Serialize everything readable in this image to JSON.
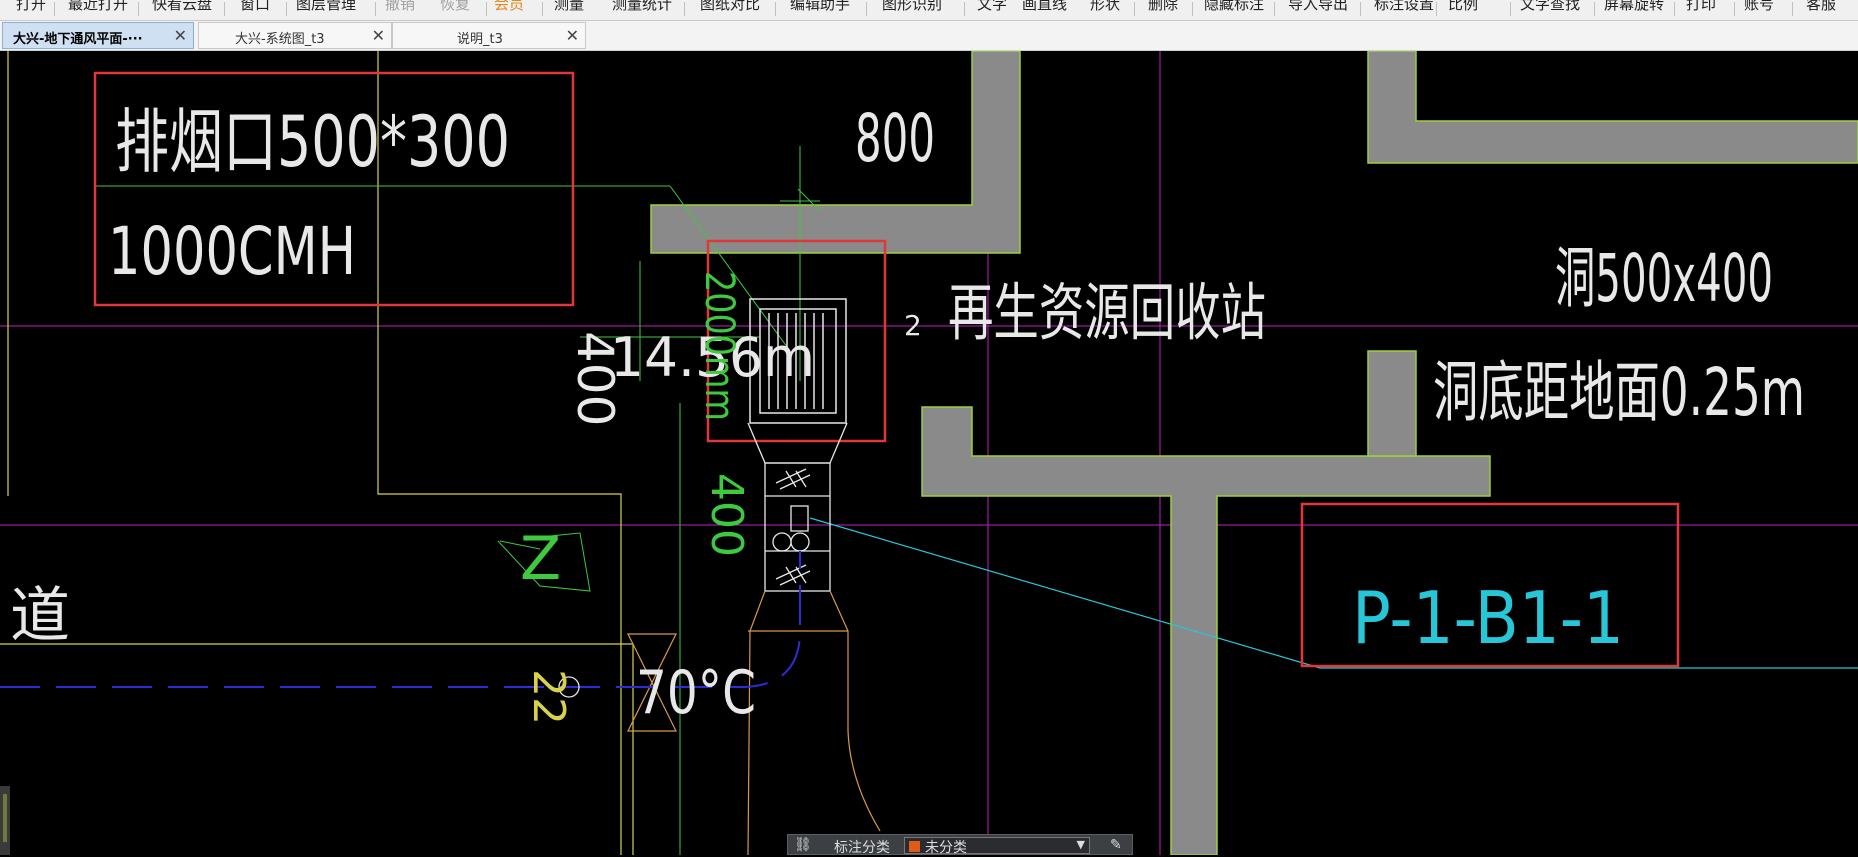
{
  "menu": {
    "items": [
      {
        "label": "打开",
        "state": "normal"
      },
      {
        "label": "最近打开",
        "state": "normal"
      },
      {
        "label": "快看云盘",
        "state": "normal"
      },
      {
        "label": "窗口",
        "state": "normal"
      },
      {
        "label": "图层管理",
        "state": "normal"
      },
      {
        "label": "撤销",
        "state": "disabled"
      },
      {
        "label": "恢复",
        "state": "disabled"
      },
      {
        "label": "会员",
        "state": "highlight"
      },
      {
        "label": "测量",
        "state": "normal"
      },
      {
        "label": "测量统计",
        "state": "normal"
      },
      {
        "label": "图纸对比",
        "state": "normal"
      },
      {
        "label": "编辑助手",
        "state": "normal"
      },
      {
        "label": "图形识别",
        "state": "normal"
      },
      {
        "label": "文字",
        "state": "normal"
      },
      {
        "label": "画直线",
        "state": "normal"
      },
      {
        "label": "形状",
        "state": "normal"
      },
      {
        "label": "删除",
        "state": "normal"
      },
      {
        "label": "隐藏标注",
        "state": "normal"
      },
      {
        "label": "导入导出",
        "state": "normal"
      },
      {
        "label": "标注设置",
        "state": "normal"
      },
      {
        "label": "比例",
        "state": "normal"
      },
      {
        "label": "文字查找",
        "state": "normal"
      },
      {
        "label": "屏幕旋转",
        "state": "normal"
      },
      {
        "label": "打印",
        "state": "normal"
      },
      {
        "label": "账号",
        "state": "normal"
      },
      {
        "label": "客服",
        "state": "normal"
      }
    ]
  },
  "tabs": [
    {
      "label": "大兴-地下通风平面-···",
      "active": true,
      "close": "✕"
    },
    {
      "label": "大兴-系统图_t3",
      "active": false,
      "close": "✕"
    },
    {
      "label": "说明_t3",
      "active": false,
      "close": "✕"
    }
  ],
  "drawing": {
    "annotation_exhaust": {
      "line1": "排烟口500*300",
      "line2": "1000CMH"
    },
    "dim_800": "800",
    "dim_400_left": "400",
    "dim_400_vertical": "400",
    "dim_2000": "2000mm",
    "elevation": "14.56m",
    "small_2": "2",
    "room_label": "再生资源回收站",
    "opening": {
      "line1": "洞500x400",
      "line2": "洞底距地面0.25m"
    },
    "equipment_tag": "P-1-B1-1",
    "temp": "70°C",
    "bottom_22": "22",
    "left_char": "道",
    "green_mark": "Z"
  },
  "colors": {
    "wall": "#8a8a8a",
    "wall_edge": "#9ecf3a",
    "text_white": "#e8e8e8",
    "red_box": "#e0373a",
    "green": "#3ec93e",
    "magenta": "#c020c0",
    "cyan": "#27c7d8",
    "yellow": "#d8d14a",
    "orange": "#d89a4a",
    "blue": "#2d2dd8"
  },
  "float_toolbar": {
    "label": "标注分类",
    "selected": "未分类",
    "dropdown": "▼",
    "icon_left": "link-icon",
    "icon_right": "edit-icon"
  }
}
